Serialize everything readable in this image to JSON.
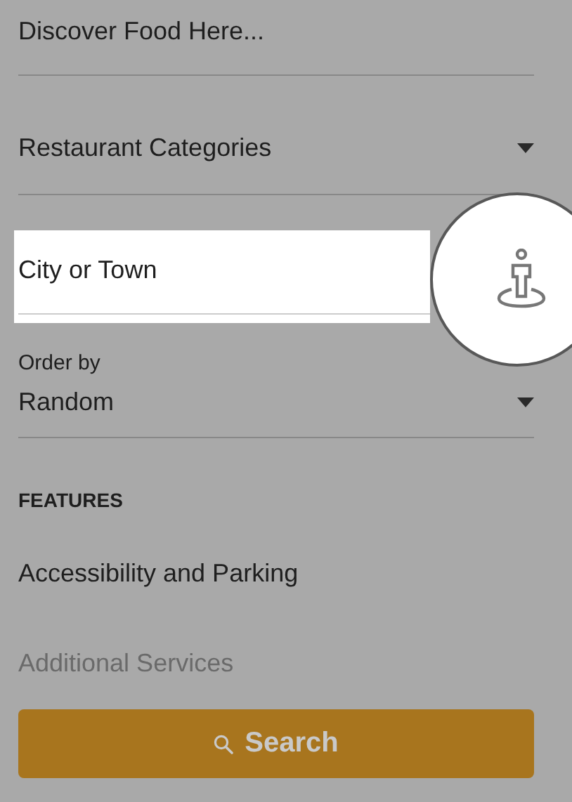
{
  "search_field": {
    "placeholder": "Discover Food Here..."
  },
  "category_dropdown": {
    "label": "Restaurant Categories"
  },
  "city_field": {
    "placeholder": "City or Town",
    "highlighted": true
  },
  "order_by": {
    "label": "Order by",
    "value": "Random"
  },
  "features": {
    "heading": "FEATURES",
    "items": [
      "Accessibility and Parking",
      "Additional Services"
    ]
  },
  "search_button": {
    "label": "Search"
  }
}
